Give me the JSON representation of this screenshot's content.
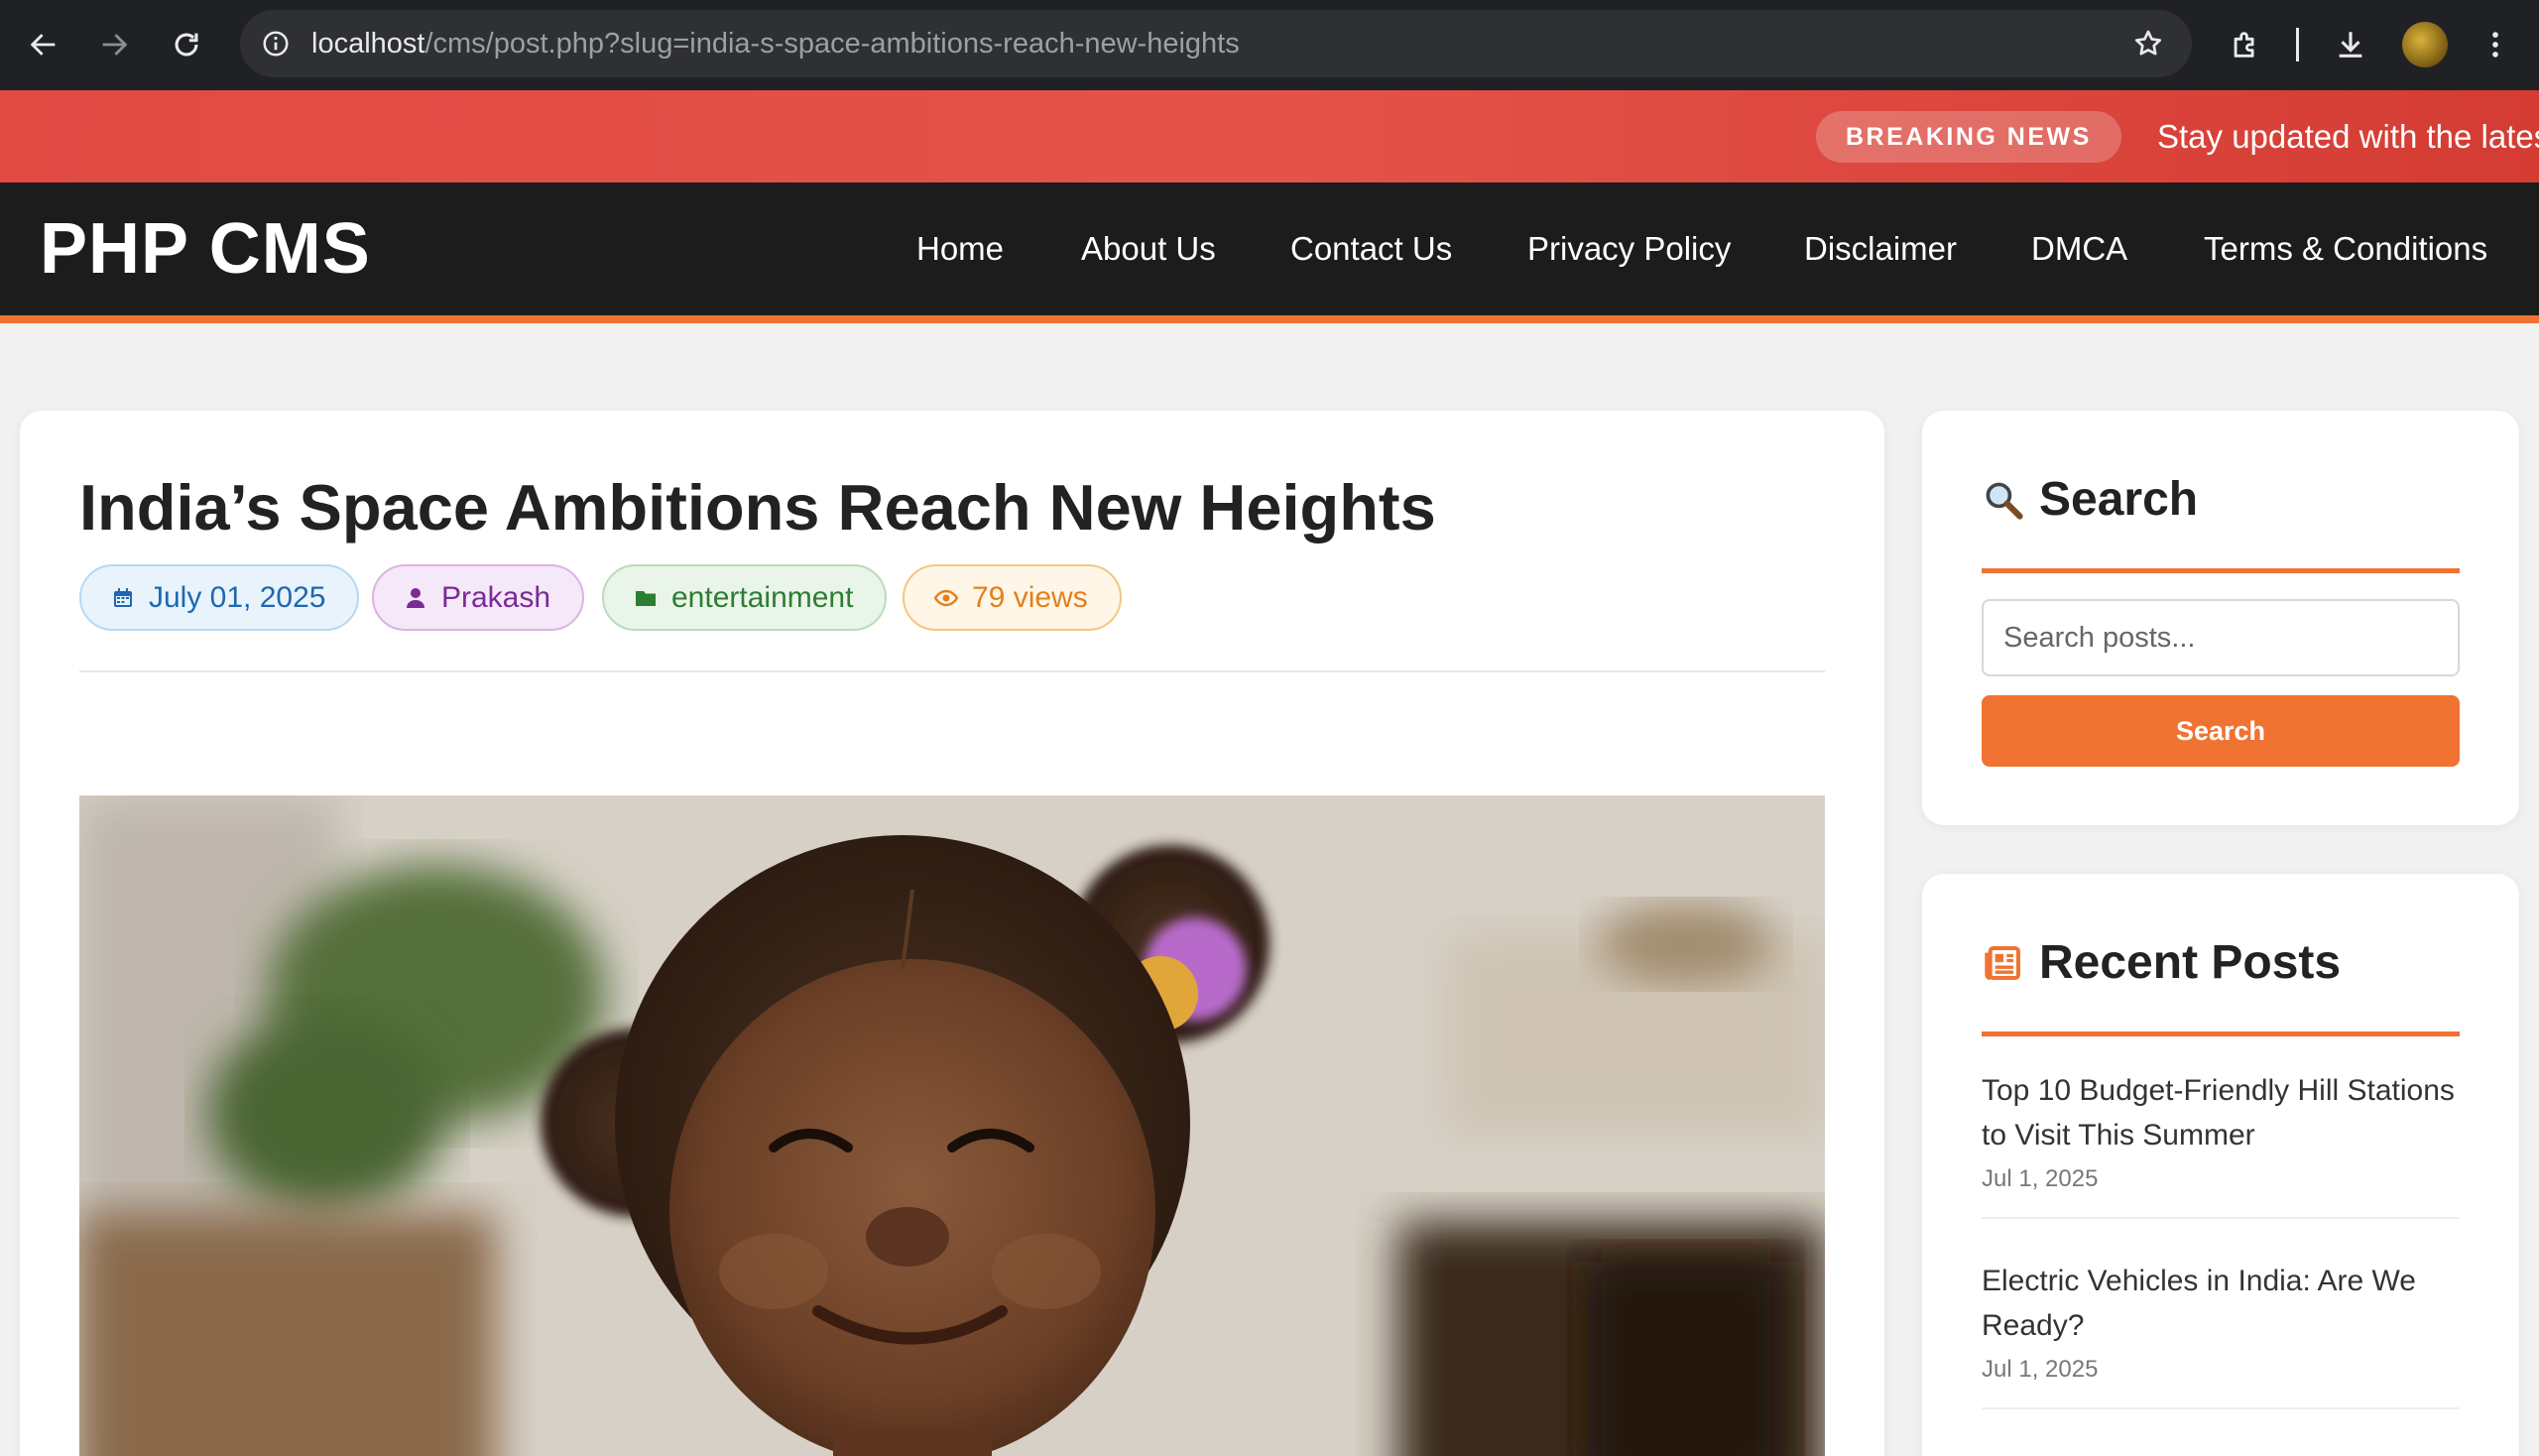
{
  "browser": {
    "url_host": "localhost",
    "url_path": "/cms/post.php?slug=india-s-space-ambitions-reach-new-heights",
    "icons": [
      "back-arrow-icon",
      "forward-arrow-icon",
      "reload-icon",
      "site-info-icon",
      "bookmark-star-icon",
      "extensions-puzzle-icon",
      "download-icon",
      "profile-avatar",
      "kebab-menu-icon"
    ]
  },
  "breaking": {
    "badge": "BREAKING NEWS",
    "ticker": "Stay updated with the lates"
  },
  "header": {
    "logo": "PHP CMS",
    "nav": [
      "Home",
      "About Us",
      "Contact Us",
      "Privacy Policy",
      "Disclaimer",
      "DMCA",
      "Terms & Conditions"
    ]
  },
  "post": {
    "title": "India’s Space Ambitions Reach New Heights",
    "date": "July 01, 2025",
    "author": "Prakash",
    "category": "entertainment",
    "views": "79 views",
    "image_alt": "Smiling child with hair puffs"
  },
  "sidebar": {
    "search": {
      "heading": "Search",
      "placeholder": "Search posts...",
      "button": "Search"
    },
    "recent": {
      "heading": "Recent Posts",
      "items": [
        {
          "title": "Top 10 Budget-Friendly Hill Stations to Visit This Summer",
          "date": "Jul 1, 2025"
        },
        {
          "title": "Electric Vehicles in India: Are We Ready?",
          "date": "Jul 1, 2025"
        }
      ]
    }
  },
  "colors": {
    "accent": "#f07331",
    "breaking_bg": "#e04a43",
    "header_bg": "#1c1c1c",
    "page_bg": "#f1f1f1"
  }
}
